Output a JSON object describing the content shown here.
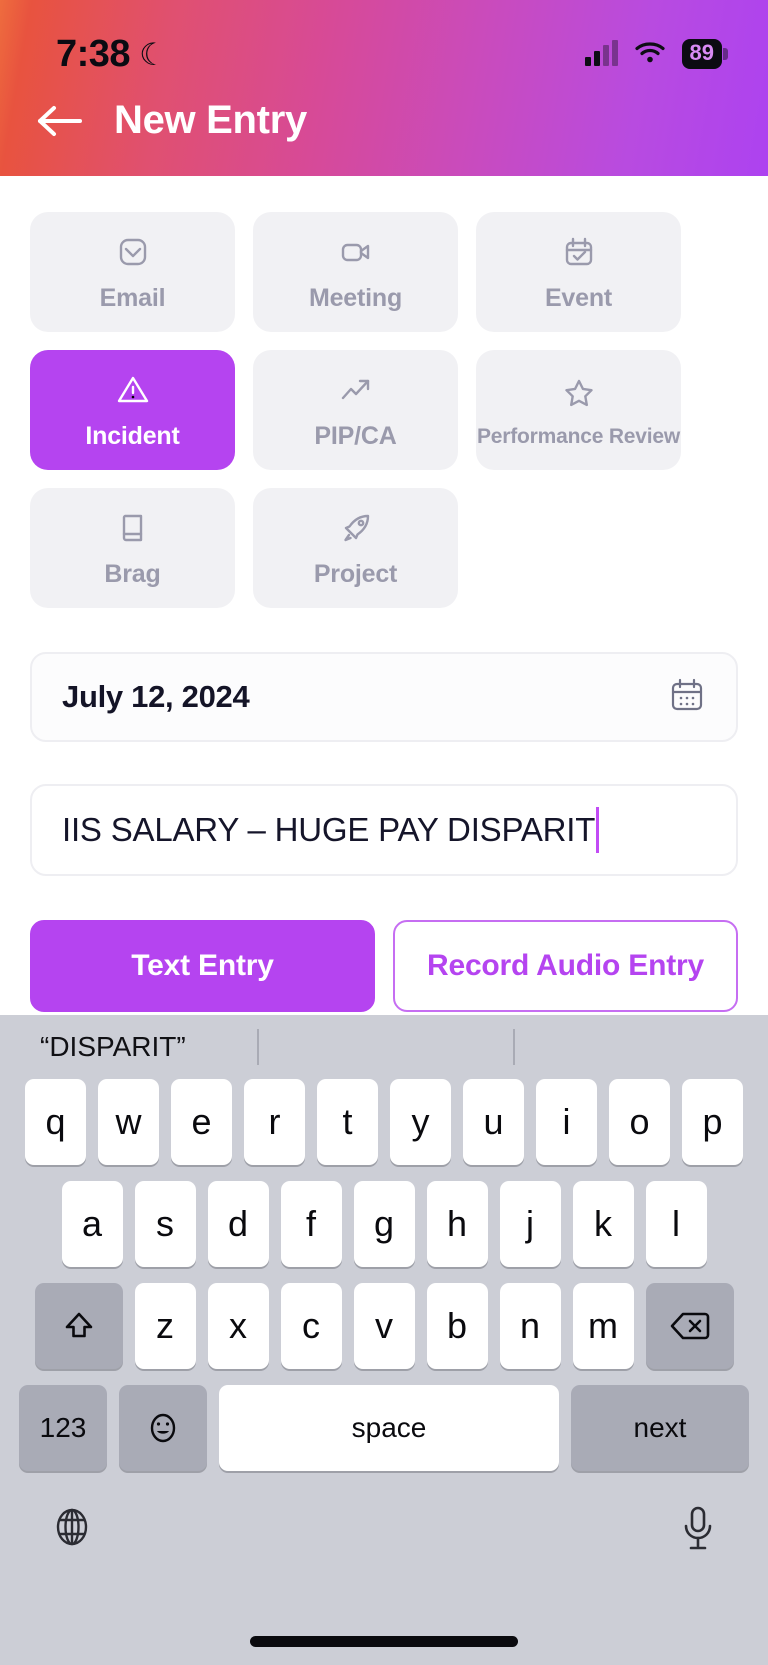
{
  "status_bar": {
    "time": "7:38",
    "moon_icon": "crescent-moon-icon",
    "battery_percent": "89",
    "signal_icon": "cellular-signal-icon",
    "wifi_icon": "wifi-icon"
  },
  "header": {
    "title": "New Entry",
    "back_icon": "back-arrow-icon",
    "gradient_start": "#ee6c3e",
    "gradient_end": "#ad42f0"
  },
  "entry_types": [
    {
      "label": "Email",
      "icon": "envelope-icon",
      "selected": false
    },
    {
      "label": "Meeting",
      "icon": "video-camera-icon",
      "selected": false
    },
    {
      "label": "Event",
      "icon": "calendar-check-icon",
      "selected": false
    },
    {
      "label": "Incident",
      "icon": "warning-triangle-icon",
      "selected": true
    },
    {
      "label": "PIP/CA",
      "icon": "trending-up-icon",
      "selected": false
    },
    {
      "label": "Performance Review",
      "icon": "star-icon",
      "selected": false
    },
    {
      "label": "Brag",
      "icon": "book-icon",
      "selected": false
    },
    {
      "label": "Project",
      "icon": "rocket-icon",
      "selected": false
    }
  ],
  "date_field": {
    "value": "July 12, 2024",
    "icon": "calendar-icon"
  },
  "title_field": {
    "value": "IIS SALARY – HUGE PAY DISPARIT",
    "placeholder": "Entry title",
    "caret_color": "#c24bf5"
  },
  "actions": {
    "text_entry": "Text Entry",
    "record_audio": "Record Audio Entry",
    "accent": "#b544f0"
  },
  "keyboard": {
    "suggestion": "“DISPARIT”",
    "row1": [
      "q",
      "w",
      "e",
      "r",
      "t",
      "y",
      "u",
      "i",
      "o",
      "p"
    ],
    "row2": [
      "a",
      "s",
      "d",
      "f",
      "g",
      "h",
      "j",
      "k",
      "l"
    ],
    "row3": [
      "z",
      "x",
      "c",
      "v",
      "b",
      "n",
      "m"
    ],
    "shift_icon": "shift-arrow-icon",
    "backspace_icon": "backspace-icon",
    "numeric_key": "123",
    "emoji_icon": "emoji-smiley-icon",
    "space_key": "space",
    "next_key": "next",
    "globe_icon": "globe-icon",
    "mic_icon": "microphone-icon"
  }
}
